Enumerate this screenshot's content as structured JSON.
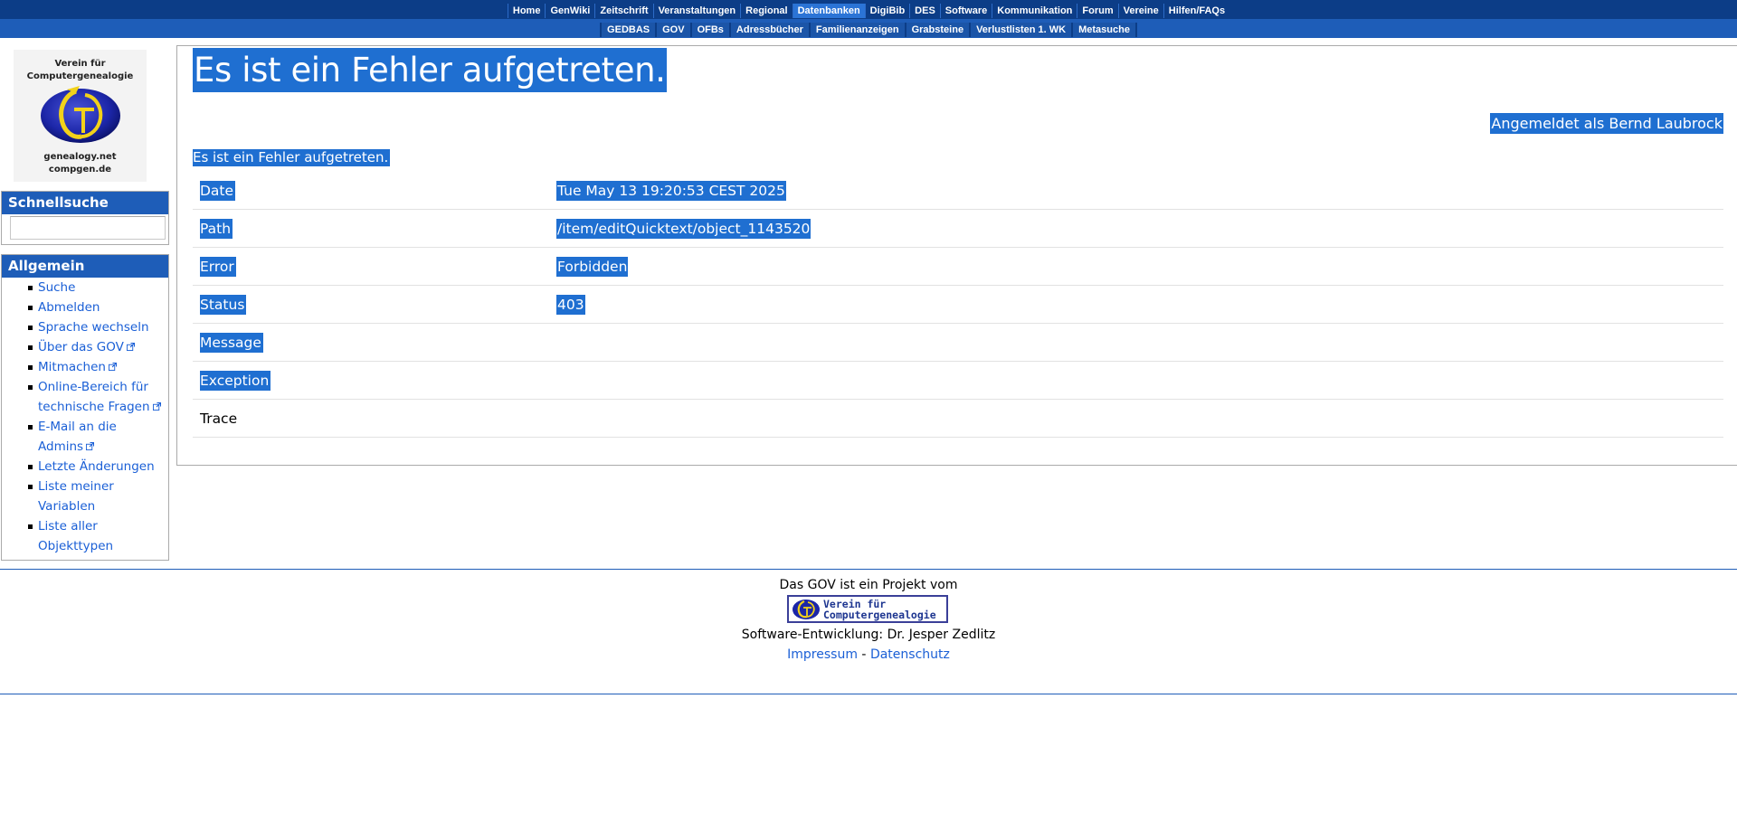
{
  "nav": {
    "main": [
      "Home",
      "GenWiki",
      "Zeitschrift",
      "Veranstaltungen",
      "Regional",
      "Datenbanken",
      "DigiBib",
      "DES",
      "Software",
      "Kommunikation",
      "Forum",
      "Vereine",
      "Hilfen/FAQs"
    ],
    "main_active": "Datenbanken",
    "sub": [
      "GEDBAS",
      "GOV",
      "OFBs",
      "Adressbücher",
      "Familienanzeigen",
      "Grabsteine",
      "Verlustlisten 1. WK",
      "Metasuche"
    ]
  },
  "logo": {
    "line1": "Verein für",
    "line2": "Computergenealogie",
    "line3": "genealogy.net",
    "line4": "compgen.de"
  },
  "quicksearch": {
    "title": "Schnellsuche",
    "value": ""
  },
  "general": {
    "title": "Allgemein",
    "items": [
      {
        "label": "Suche",
        "external": false
      },
      {
        "label": "Abmelden",
        "external": false
      },
      {
        "label": "Sprache wechseln",
        "external": false
      },
      {
        "label": "Über das GOV",
        "external": true
      },
      {
        "label": "Mitmachen",
        "external": true
      },
      {
        "label": "Online-Bereich für technische Fragen",
        "external": true
      },
      {
        "label": "E-Mail an die Admins",
        "external": true
      },
      {
        "label": "Letzte Änderungen",
        "external": false
      },
      {
        "label": "Liste meiner Variablen",
        "external": false
      },
      {
        "label": "Liste aller Objekttypen",
        "external": false
      }
    ]
  },
  "content": {
    "heading": "Es ist ein Fehler aufgetreten.",
    "user_line": "Angemeldet als Bernd Laubrock",
    "subheading": "Es ist ein Fehler aufgetreten.",
    "rows": [
      {
        "key": "Date",
        "value": "Tue May 13 19:20:53 CEST 2025",
        "selected": true
      },
      {
        "key": "Path",
        "value": "/item/editQuicktext/object_1143520",
        "selected": true
      },
      {
        "key": "Error",
        "value": "Forbidden",
        "selected": true
      },
      {
        "key": "Status",
        "value": "403",
        "selected": true
      },
      {
        "key": "Message",
        "value": "",
        "selected": true
      },
      {
        "key": "Exception",
        "value": "",
        "selected": true
      },
      {
        "key": "Trace",
        "value": "",
        "selected": false
      }
    ]
  },
  "footer": {
    "project_line": "Das GOV ist ein Projekt vom",
    "badge_line1": "Verein für",
    "badge_line2": "Computergenealogie",
    "dev_line": "Software-Entwicklung: Dr. Jesper Zedlitz",
    "impressum": "Impressum",
    "separator": "-",
    "datenschutz": "Datenschutz"
  },
  "colors": {
    "nav_dark": "#0c3d87",
    "nav_light": "#1e5db8",
    "selection": "#1f6fd1",
    "link": "#1a5fd6"
  }
}
